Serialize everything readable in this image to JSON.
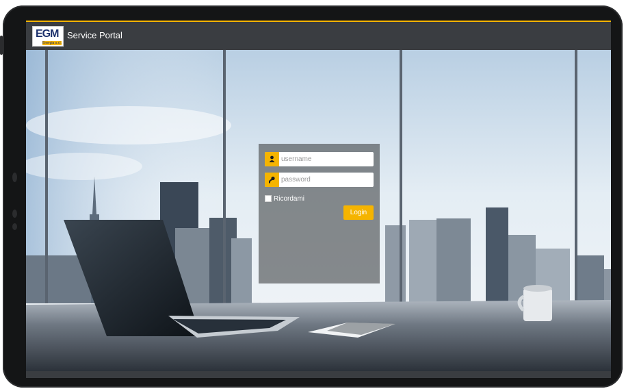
{
  "header": {
    "logo_text": "EGM",
    "logo_tagline": "Energia s.r.l.",
    "title": "Service Portal"
  },
  "login": {
    "username_placeholder": "username",
    "password_placeholder": "password",
    "remember_label": "Ricordami",
    "submit_label": "Login",
    "username_icon": "user-icon",
    "password_icon": "key-icon"
  },
  "colors": {
    "accent": "#f5b400",
    "header_bg": "#3a3d41",
    "device_frame": "#141516"
  }
}
